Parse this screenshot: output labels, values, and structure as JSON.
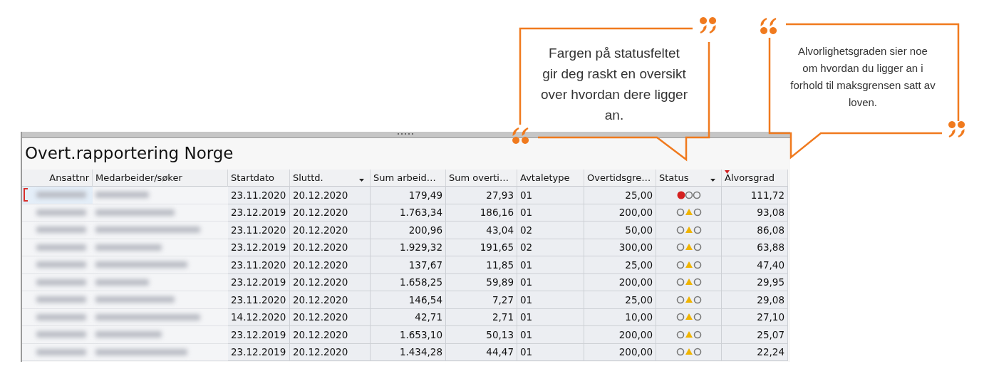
{
  "callouts": [
    {
      "text": "Fargen på statusfeltet gir deg raskt en oversikt over hvordan dere ligger an."
    },
    {
      "text": "Alvorlighetsgraden sier noe om hvordan du ligger an i forhold til maksgrensen satt av loven."
    }
  ],
  "report": {
    "title": "Overt.rapportering Norge",
    "columns": [
      {
        "label": "Ansattnr",
        "filter": false,
        "sorted": false
      },
      {
        "label": "Medarbeider/søker",
        "filter": false,
        "sorted": false
      },
      {
        "label": "Startdato",
        "filter": false,
        "sorted": false
      },
      {
        "label": "Sluttd.",
        "filter": true,
        "sorted": false
      },
      {
        "label": "Sum arbeid…",
        "filter": false,
        "sorted": false
      },
      {
        "label": "Sum overti…",
        "filter": false,
        "sorted": false
      },
      {
        "label": "Avtaletype",
        "filter": false,
        "sorted": false
      },
      {
        "label": "Overtidsgre…",
        "filter": false,
        "sorted": false
      },
      {
        "label": "Status",
        "filter": true,
        "sorted": false
      },
      {
        "label": "Alvorsgrad",
        "filter": false,
        "sorted": true
      }
    ],
    "rows": [
      {
        "selected": true,
        "start": "23.11.2020",
        "end": "20.12.2020",
        "sum_work": "179,49",
        "sum_overtime": "27,93",
        "agreement": "01",
        "limit": "25,00",
        "kind": "red",
        "severity": "111,72"
      },
      {
        "selected": false,
        "start": "23.12.2019",
        "end": "20.12.2020",
        "sum_work": "1.763,34",
        "sum_overtime": "186,16",
        "agreement": "01",
        "limit": "200,00",
        "kind": "warning",
        "severity": "93,08"
      },
      {
        "selected": false,
        "start": "23.11.2020",
        "end": "20.12.2020",
        "sum_work": "200,96",
        "sum_overtime": "43,04",
        "agreement": "02",
        "limit": "50,00",
        "kind": "warning",
        "severity": "86,08"
      },
      {
        "selected": false,
        "start": "23.12.2019",
        "end": "20.12.2020",
        "sum_work": "1.929,32",
        "sum_overtime": "191,65",
        "agreement": "02",
        "limit": "300,00",
        "kind": "warning",
        "severity": "63,88"
      },
      {
        "selected": false,
        "start": "23.11.2020",
        "end": "20.12.2020",
        "sum_work": "137,67",
        "sum_overtime": "11,85",
        "agreement": "01",
        "limit": "25,00",
        "kind": "warning",
        "severity": "47,40"
      },
      {
        "selected": false,
        "start": "23.12.2019",
        "end": "20.12.2020",
        "sum_work": "1.658,25",
        "sum_overtime": "59,89",
        "agreement": "01",
        "limit": "200,00",
        "kind": "warning",
        "severity": "29,95"
      },
      {
        "selected": false,
        "start": "23.11.2020",
        "end": "20.12.2020",
        "sum_work": "146,54",
        "sum_overtime": "7,27",
        "agreement": "01",
        "limit": "25,00",
        "kind": "warning",
        "severity": "29,08"
      },
      {
        "selected": false,
        "start": "14.12.2020",
        "end": "20.12.2020",
        "sum_work": "42,71",
        "sum_overtime": "2,71",
        "agreement": "01",
        "limit": "10,00",
        "kind": "warning",
        "severity": "27,10"
      },
      {
        "selected": false,
        "start": "23.12.2019",
        "end": "20.12.2020",
        "sum_work": "1.653,10",
        "sum_overtime": "50,13",
        "agreement": "01",
        "limit": "200,00",
        "kind": "warning",
        "severity": "25,07"
      },
      {
        "selected": false,
        "start": "23.12.2019",
        "end": "20.12.2020",
        "sum_work": "1.434,28",
        "sum_overtime": "44,47",
        "agreement": "01",
        "limit": "200,00",
        "kind": "warning",
        "severity": "22,24"
      }
    ]
  }
}
